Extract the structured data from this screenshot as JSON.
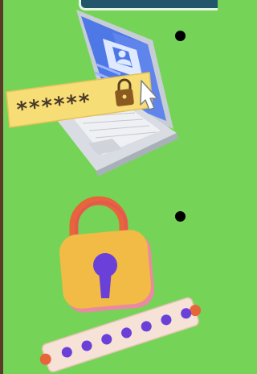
{
  "password_field": {
    "mask": "******"
  },
  "pin_field": {
    "dot_count": 7
  },
  "colors": {
    "background": "#75d457",
    "top_bar": "#22566a",
    "password_bar": "#f7dd75",
    "lock_body": "#f1bb45",
    "lock_shackle": "#e8643a",
    "keyhole": "#6a40d8",
    "pin_bar": "#f6e2d6",
    "pin_dot": "#6a40d8",
    "laptop_screen": "#4e78e6"
  },
  "icons": [
    "laptop-icon",
    "user-card-icon",
    "cursor-arrow-icon",
    "padlock-icon",
    "keyhole-icon"
  ]
}
